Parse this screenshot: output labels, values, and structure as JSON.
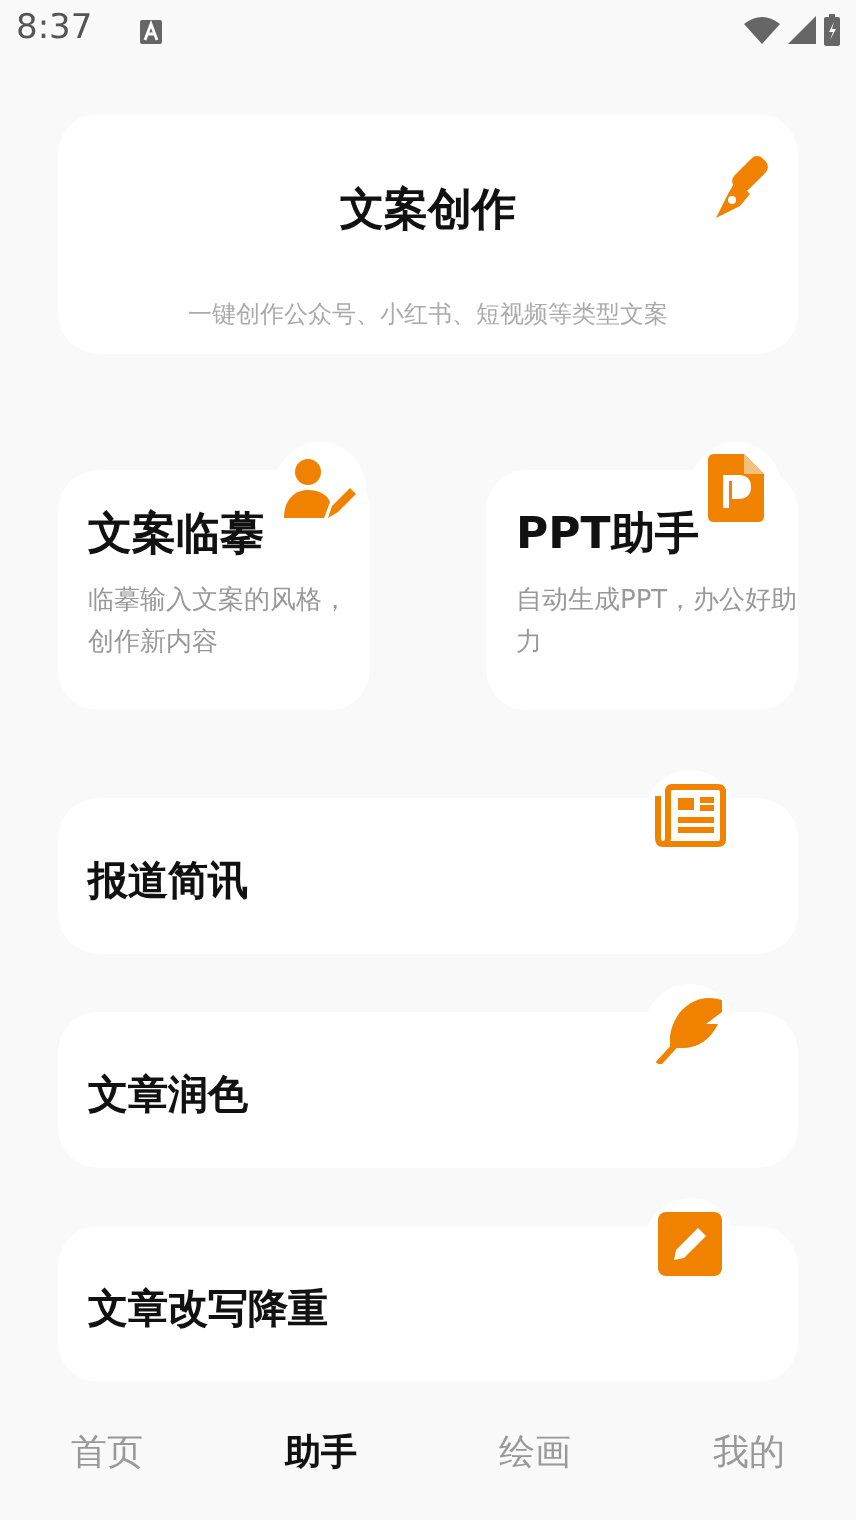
{
  "status_bar": {
    "time": "8:37"
  },
  "feature_card": {
    "title": "文案创作",
    "subtitle": "一键创作公众号、小红书、短视频等类型文案"
  },
  "tool_cards": [
    {
      "title": "文案临摹",
      "description": "临摹输入文案的风格，创作新内容"
    },
    {
      "title": "PPT助手",
      "description": "自动生成PPT，办公好助力"
    }
  ],
  "list_cards": [
    {
      "title": "报道简讯"
    },
    {
      "title": "文章润色"
    },
    {
      "title": "文章改写降重"
    }
  ],
  "bottom_nav": [
    {
      "label": "首页",
      "selected": false
    },
    {
      "label": "助手",
      "selected": true
    },
    {
      "label": "绘画",
      "selected": false
    },
    {
      "label": "我的",
      "selected": false
    }
  ]
}
